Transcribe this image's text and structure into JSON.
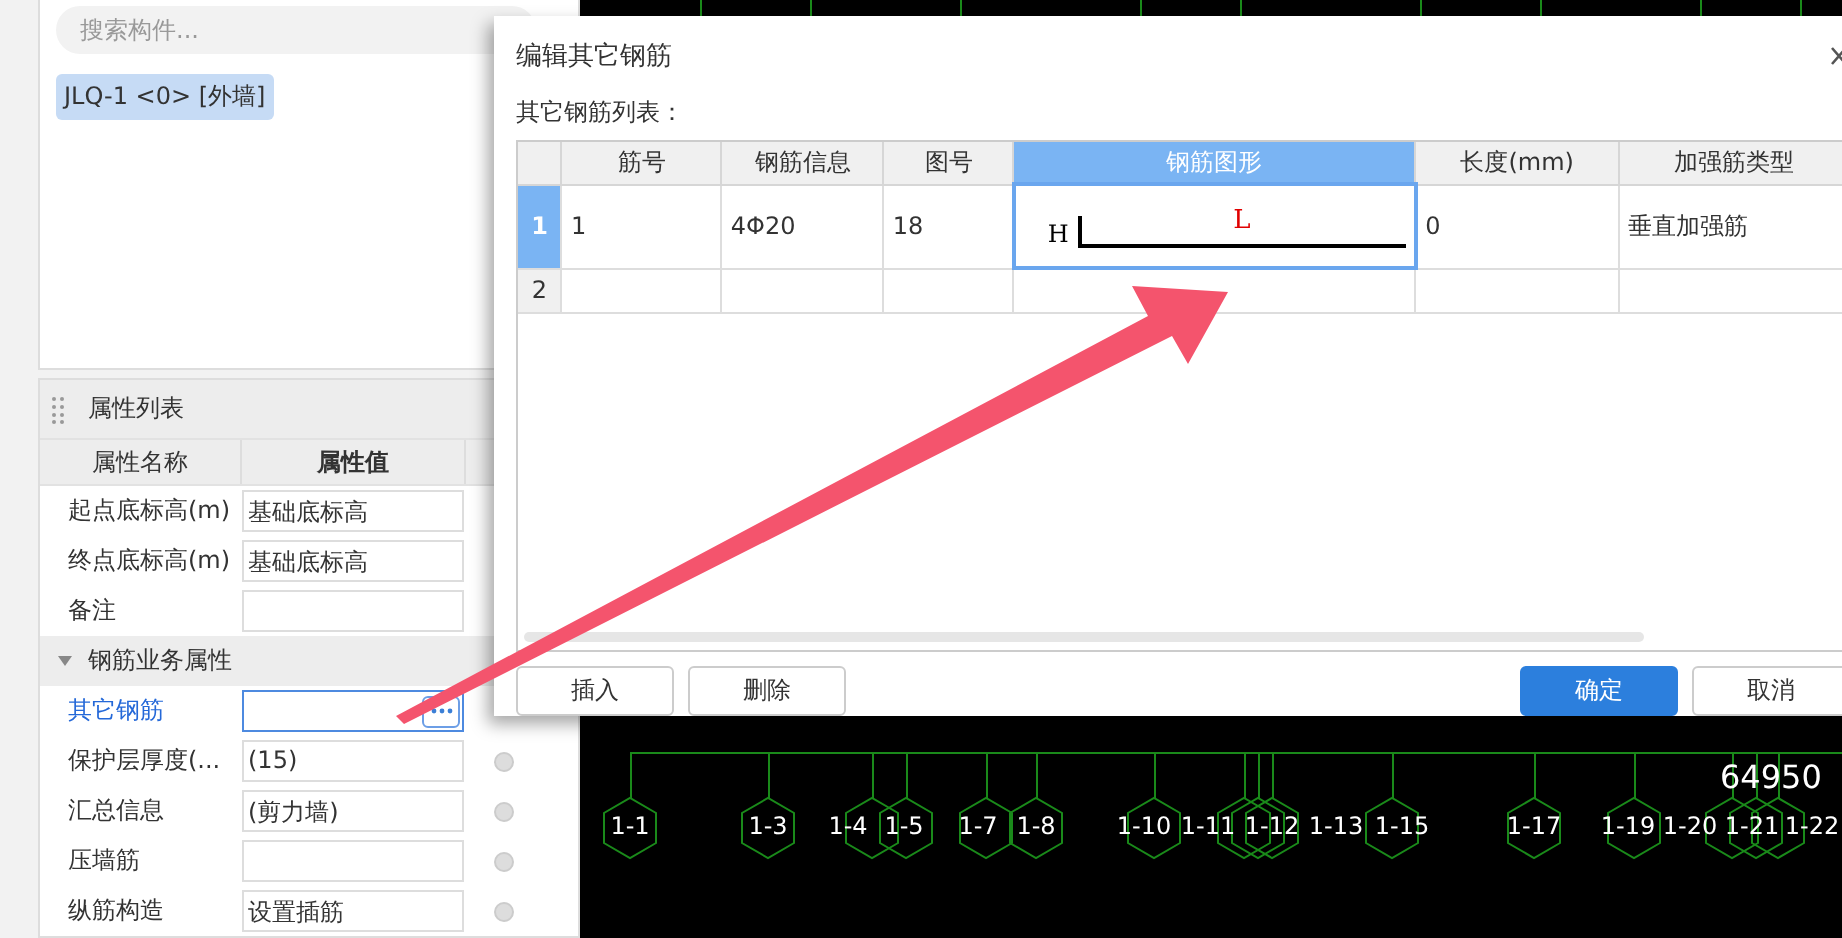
{
  "component_panel": {
    "search": {
      "placeholder": "搜索构件..."
    },
    "components": [
      {
        "label": "JLQ-1 <0> [外墙]",
        "selected": true
      }
    ]
  },
  "properties": {
    "title": "属性列表",
    "columns": [
      "属性名称",
      "属性值"
    ],
    "rows": [
      {
        "kind": "field",
        "name": "起点底标高(m)",
        "value": "基础底标高"
      },
      {
        "kind": "field",
        "name": "终点底标高(m)",
        "value": "基础底标高"
      },
      {
        "kind": "field",
        "name": "备注",
        "value": ""
      },
      {
        "kind": "group",
        "name": "钢筋业务属性",
        "expanded": true
      },
      {
        "kind": "button_field",
        "name": "其它钢筋",
        "value": "",
        "active": true
      },
      {
        "kind": "field",
        "name": "保护层厚度(...",
        "value": "(15)",
        "attached": false
      },
      {
        "kind": "field",
        "name": "汇总信息",
        "value": "(剪力墙)",
        "attached": false
      },
      {
        "kind": "field",
        "name": "压墙筋",
        "value": "",
        "attached": false
      },
      {
        "kind": "field",
        "name": "纵筋构造",
        "value": "设置插筋",
        "attached": false
      }
    ]
  },
  "drawing": {
    "total": "64950",
    "axis_labels": [
      "1-1",
      "1-3",
      "1-4",
      "1-5",
      "1-7",
      "1-8",
      "1-10",
      "1-11",
      "1-12",
      "1-13",
      "1-15",
      "1-17",
      "1-19",
      "1-20",
      "1-21",
      "1-22"
    ]
  },
  "dialog": {
    "title": "编辑其它钢筋",
    "list_label": "其它钢筋列表：",
    "columns": [
      {
        "label": "筋号",
        "selected": false
      },
      {
        "label": "钢筋信息",
        "selected": false
      },
      {
        "label": "图号",
        "selected": false
      },
      {
        "label": "钢筋图形",
        "selected": true
      },
      {
        "label": "长度(mm)",
        "selected": false
      },
      {
        "label": "加强筋类型",
        "selected": false
      }
    ],
    "rows": [
      {
        "number": "1",
        "selected": true,
        "bar_no": "1",
        "info": "4Φ20",
        "shape_no": "18",
        "shape": {
          "h": "H",
          "l": "L"
        },
        "length": "0",
        "type": "垂直加强筋"
      },
      {
        "number": "2",
        "selected": false
      }
    ],
    "buttons": [
      {
        "label": "插入",
        "kind": "default"
      },
      {
        "label": "删除",
        "kind": "default"
      },
      {
        "label": "确定",
        "kind": "primary"
      },
      {
        "label": "取消",
        "kind": "default"
      }
    ]
  }
}
